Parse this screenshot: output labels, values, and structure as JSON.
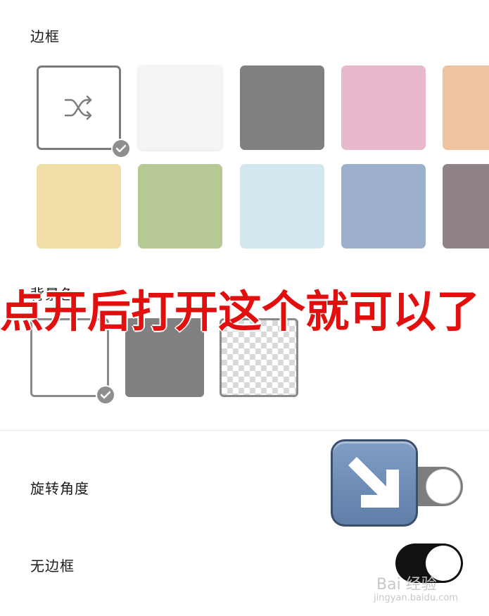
{
  "sections": {
    "border_label": "边框",
    "background_label": "背景色",
    "rotation_label": "旋转角度",
    "no_border_label": "无边框"
  },
  "border_swatches": {
    "row1": [
      {
        "name": "random",
        "color": "#ffffff",
        "selected": true,
        "icon": "shuffle-icon"
      },
      {
        "name": "white",
        "color": "#f4f4f4"
      },
      {
        "name": "gray",
        "color": "#808080"
      },
      {
        "name": "pink",
        "color": "#e8b9cc"
      },
      {
        "name": "peach",
        "color": "#efc3a0"
      }
    ],
    "row2": [
      {
        "name": "yellow",
        "color": "#f1dea6"
      },
      {
        "name": "green",
        "color": "#b6c995"
      },
      {
        "name": "light-blue",
        "color": "#d2e8ee"
      },
      {
        "name": "blue",
        "color": "#9cb0cc"
      },
      {
        "name": "mauve",
        "color": "#8f8388"
      }
    ]
  },
  "background_swatches": [
    {
      "name": "white",
      "color": "#ffffff",
      "selected": true
    },
    {
      "name": "gray",
      "color": "#808080"
    },
    {
      "name": "transparent",
      "color": "checker"
    }
  ],
  "toggles": {
    "rotation": false,
    "no_border": true
  },
  "overlay": {
    "instruction_text": "点开后打开这个就可以了"
  },
  "watermark": {
    "text": "Bai 经验",
    "sub": "jingyan.baidu.com"
  }
}
